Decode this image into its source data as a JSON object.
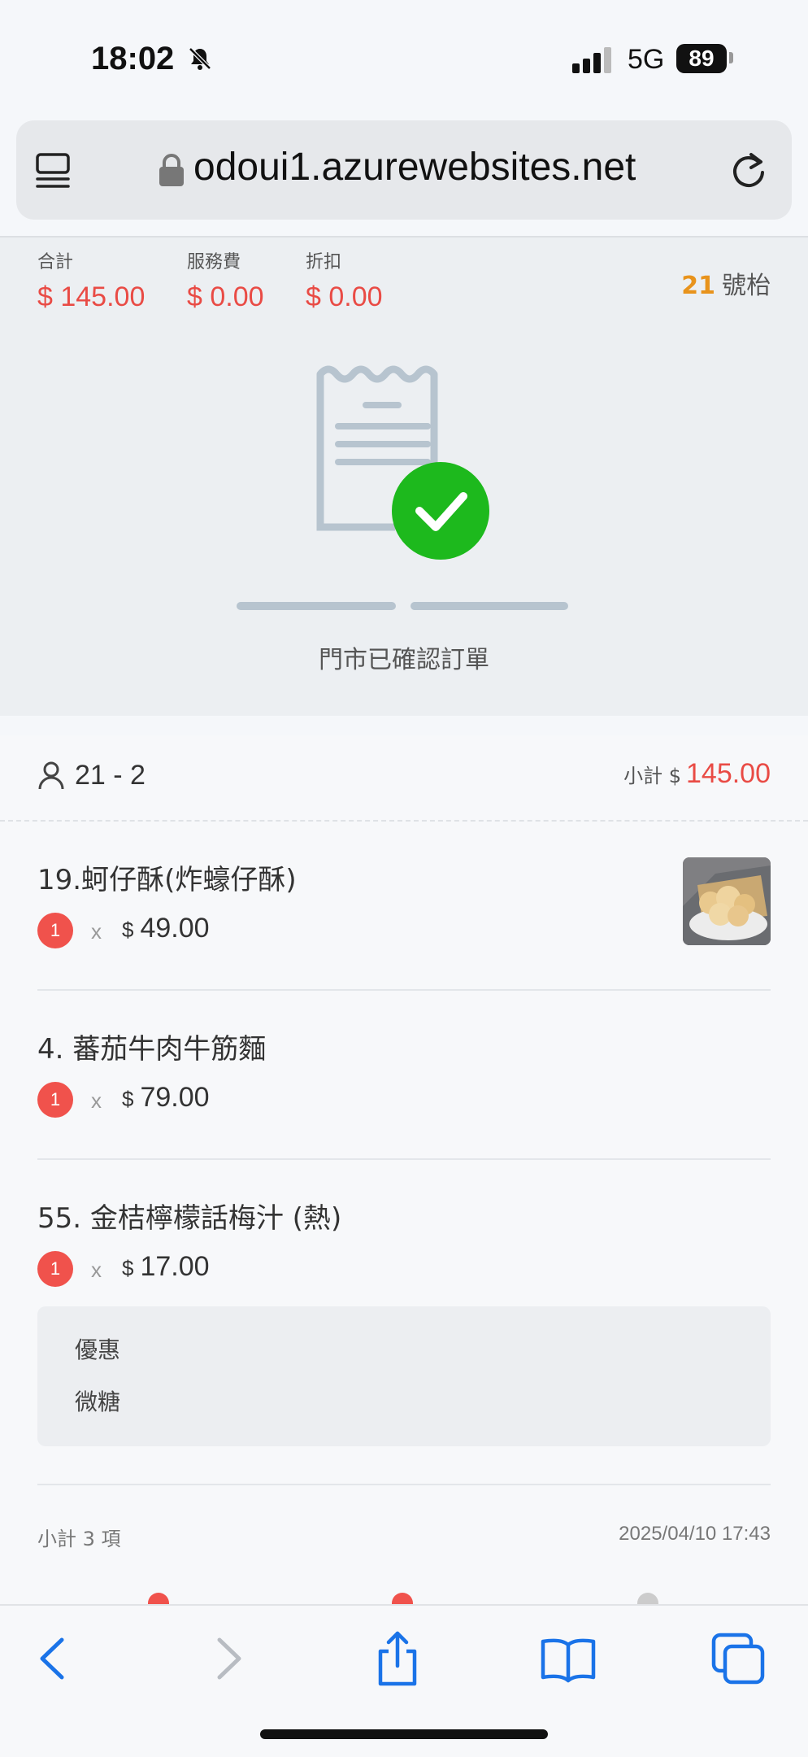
{
  "status_bar": {
    "time": "18:02",
    "network": "5G",
    "battery": "89"
  },
  "url_bar": {
    "url": "odoui1.azurewebsites.net"
  },
  "summary": {
    "total_label": "合計",
    "total_value": "$ 145.00",
    "service_label": "服務費",
    "service_value": "$ 0.00",
    "discount_label": "折扣",
    "discount_value": "$ 0.00",
    "table_number": "21",
    "table_suffix": "號枱",
    "status_text": "門市已確認訂單"
  },
  "order": {
    "guest": "21 - 2",
    "subtotal_label": "小計 $",
    "subtotal_value": "145.00",
    "items": [
      {
        "name": "19.蚵仔酥(炸蠔仔酥)",
        "qty": "1",
        "times": "x",
        "currency": "$",
        "price": "49.00",
        "has_image": true
      },
      {
        "name": "4. 蕃茄牛肉牛筋麵",
        "qty": "1",
        "times": "x",
        "currency": "$",
        "price": "79.00",
        "has_image": false
      },
      {
        "name": "55. 金桔檸檬話梅汁 (熱)",
        "qty": "1",
        "times": "x",
        "currency": "$",
        "price": "17.00",
        "has_image": false
      }
    ],
    "notes": [
      "優惠",
      "微糖"
    ],
    "footer_count": "小計 3 項",
    "footer_date": "2025/04/10 17:43"
  },
  "colors": {
    "accent_red": "#e94b45",
    "table_orange": "#e8931c",
    "success_green": "#1db91d",
    "ios_blue": "#1a73e8"
  },
  "icons": {
    "status": [
      "bell-slash-icon",
      "signal-icon"
    ],
    "url_bar": [
      "menu-icon",
      "lock-icon",
      "reload-icon"
    ],
    "toolbar": [
      "back-icon",
      "forward-icon",
      "share-icon",
      "bookmarks-icon",
      "tabs-icon"
    ]
  }
}
